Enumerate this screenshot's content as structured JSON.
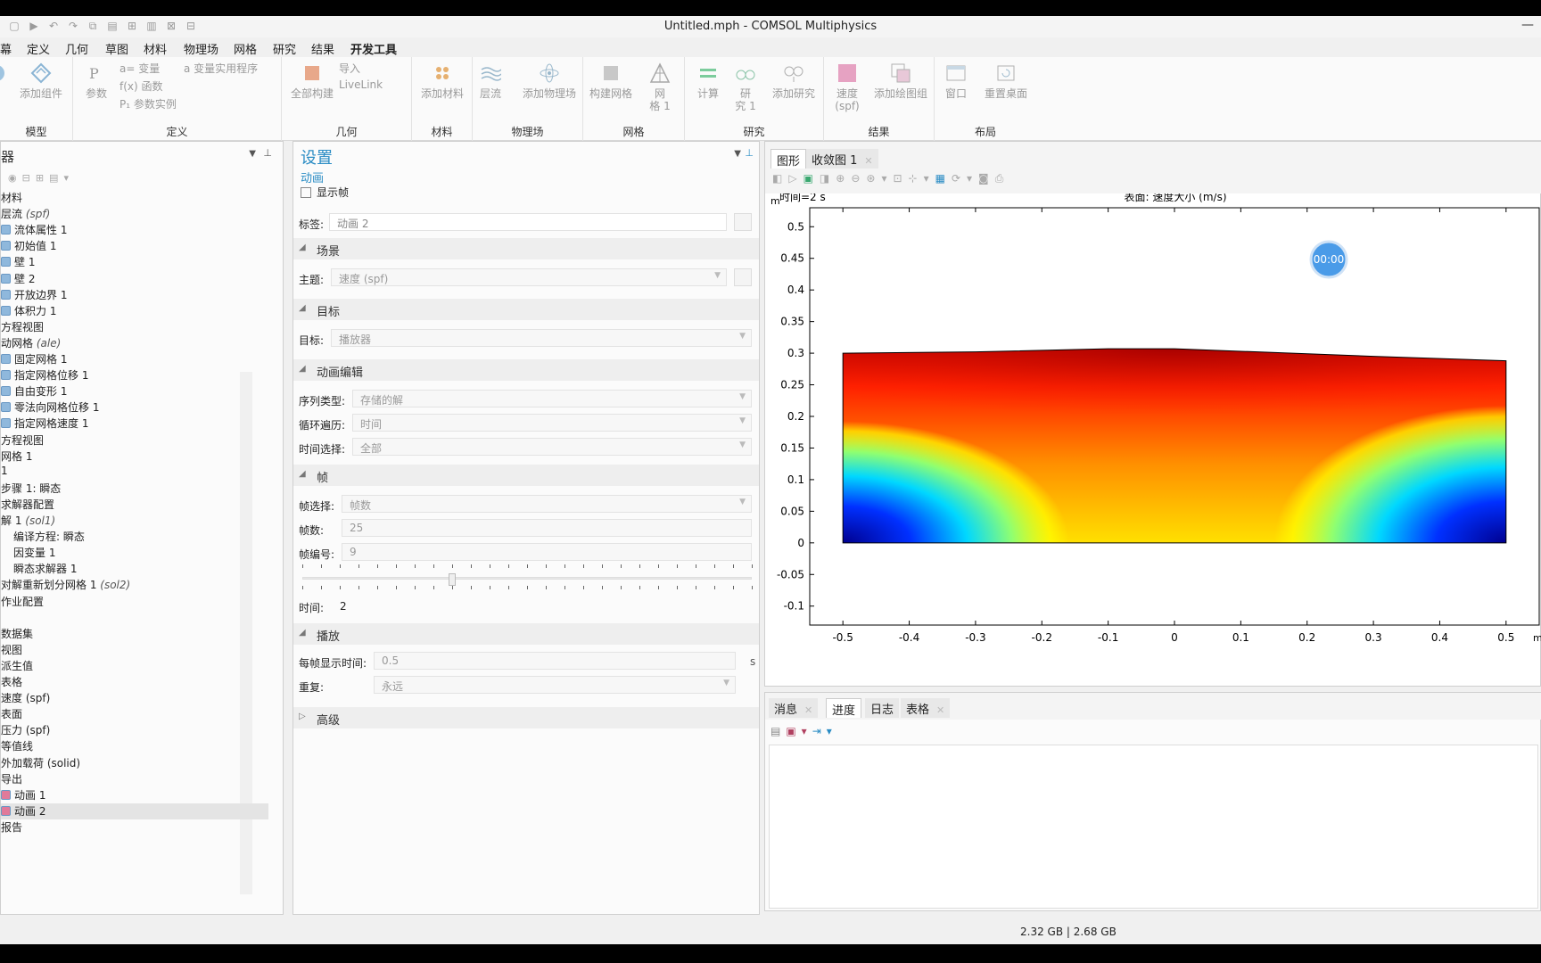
{
  "window": {
    "title": "Untitled.mph - COMSOL Multiphysics"
  },
  "menu": [
    "幕",
    "定义",
    "几何",
    "草图",
    "材料",
    "物理场",
    "网格",
    "研究",
    "结果",
    "开发工具"
  ],
  "ribbon": {
    "groups": {
      "model": "模型",
      "definitions": "定义",
      "geometry": "几何",
      "materials": "材料",
      "physics": "物理场",
      "mesh": "网格",
      "study": "研究",
      "results": "结果",
      "layout": "布局"
    },
    "add_component": "添加组件",
    "parameters": "参数",
    "variables": "a= 变量",
    "functions": "f(x) 函数",
    "param_case": "P₁ 参数实例",
    "var_utils": "a 变量实用程序",
    "build_all": "全部构建",
    "import": "导入",
    "livelink": "LiveLink",
    "add_material": "添加材料",
    "laminar": "层流",
    "add_physics": "添加物理场",
    "build_mesh": "构建网格",
    "mesh1_a": "网",
    "mesh1_b": "格 1",
    "compute": "计算",
    "study1_a": "研",
    "study1_b": "究 1",
    "add_study": "添加研究",
    "velocity_a": "速度",
    "velocity_b": "(spf)",
    "add_plot_group": "添加绘图组",
    "windows": "窗口",
    "reset_desktop": "重置桌面"
  },
  "model_builder": {
    "title": "器",
    "items": [
      {
        "text": "材料",
        "italic": ""
      },
      {
        "text": "层流 ",
        "italic": "(spf)"
      },
      {
        "text": "流体属性 1",
        "italic": ""
      },
      {
        "text": "初始值 1",
        "italic": ""
      },
      {
        "text": "壁 1",
        "italic": ""
      },
      {
        "text": "壁 2",
        "italic": ""
      },
      {
        "text": "开放边界 1",
        "italic": ""
      },
      {
        "text": "体积力 1",
        "italic": ""
      },
      {
        "text": "方程视图",
        "italic": ""
      },
      {
        "text": "动网格 ",
        "italic": "(ale)"
      },
      {
        "text": "固定网格 1",
        "italic": ""
      },
      {
        "text": "指定网格位移 1",
        "italic": ""
      },
      {
        "text": "自由变形 1",
        "italic": ""
      },
      {
        "text": "零法向网格位移 1",
        "italic": ""
      },
      {
        "text": "指定网格速度 1",
        "italic": ""
      },
      {
        "text": "方程视图",
        "italic": ""
      },
      {
        "text": "网格 1",
        "italic": ""
      },
      {
        "text": "1",
        "italic": ""
      },
      {
        "text": "步骤 1: 瞬态",
        "italic": ""
      },
      {
        "text": "求解器配置",
        "italic": ""
      },
      {
        "text": "解 1 ",
        "italic": "(sol1)"
      },
      {
        "text": "编译方程: 瞬态",
        "italic": ""
      },
      {
        "text": "因变量 1",
        "italic": ""
      },
      {
        "text": "瞬态求解器 1",
        "italic": ""
      },
      {
        "text": "对解重新划分网格 1 ",
        "italic": "(sol2)"
      },
      {
        "text": "作业配置",
        "italic": ""
      },
      {
        "text": "",
        "italic": ""
      },
      {
        "text": "数据集",
        "italic": ""
      },
      {
        "text": "视图",
        "italic": ""
      },
      {
        "text": "派生值",
        "italic": ""
      },
      {
        "text": "表格",
        "italic": ""
      },
      {
        "text": "速度 (spf)",
        "italic": ""
      },
      {
        "text": "表面",
        "italic": ""
      },
      {
        "text": "压力 (spf)",
        "italic": ""
      },
      {
        "text": "等值线",
        "italic": ""
      },
      {
        "text": "外加载荷 (solid)",
        "italic": ""
      },
      {
        "text": "导出",
        "italic": ""
      },
      {
        "text": "动画 1",
        "italic": ""
      },
      {
        "text": "动画 2",
        "italic": ""
      },
      {
        "text": "报告",
        "italic": ""
      }
    ]
  },
  "settings": {
    "title": "设置",
    "subtitle": "动画",
    "show_frame": "显示帧",
    "label_label": "标签:",
    "label_value": "动画 2",
    "sections": {
      "scene": "场景",
      "target": "目标",
      "editing": "动画编辑",
      "frames": "帧",
      "playing": "播放",
      "advanced": "高级"
    },
    "subject_label": "主题:",
    "subject_value": "速度 (spf)",
    "target_label": "目标:",
    "target_value": "播放器",
    "seq_type_label": "序列类型:",
    "seq_type_value": "存储的解",
    "loop_label": "循环遍历:",
    "loop_value": "时间",
    "time_sel_label": "时间选择:",
    "time_sel_value": "全部",
    "frame_sel_label": "帧选择:",
    "frame_sel_value": "帧数",
    "frames_label": "帧数:",
    "frames_value": "25",
    "frame_num_label": "帧编号:",
    "frame_num_value": "9",
    "slider_position": 0.33,
    "time_label": "时间:",
    "time_value": "2",
    "display_time_label": "每帧显示时间:",
    "display_time_value": "0.5",
    "display_time_unit": "s",
    "repeat_label": "重复:",
    "repeat_value": "永远"
  },
  "graphics": {
    "tab_graphics": "图形",
    "tab_convergence": "收敛图 1",
    "time_text": "时间=2 s",
    "surface_title": "表面: 速度大小 (m/s)",
    "yunit": "m",
    "xunit": "m",
    "timer": "00:00"
  },
  "chart_data": {
    "type": "heatmap",
    "title": "表面: 速度大小 (m/s)",
    "subtitle": "时间=2 s",
    "xlabel": "m",
    "ylabel": "m",
    "xlim": [
      -0.55,
      0.55
    ],
    "ylim": [
      -0.13,
      0.53
    ],
    "xticks": [
      "-0.5",
      "-0.4",
      "-0.3",
      "-0.2",
      "-0.1",
      "0",
      "0.1",
      "0.2",
      "0.3",
      "0.4",
      "0.5"
    ],
    "yticks": [
      "0.5",
      "0.45",
      "0.4",
      "0.35",
      "0.3",
      "0.25",
      "0.2",
      "0.15",
      "0.1",
      "0.05",
      "0",
      "-0.05",
      "-0.1"
    ],
    "domain_top": [
      [
        -0.5,
        0.3
      ],
      [
        -0.3,
        0.302
      ],
      [
        -0.1,
        0.307
      ],
      [
        0.0,
        0.307
      ],
      [
        0.1,
        0.303
      ],
      [
        0.3,
        0.295
      ],
      [
        0.5,
        0.288
      ]
    ],
    "domain_bottom": 0
  },
  "messages": {
    "tabs": [
      "消息",
      "进度",
      "日志",
      "表格"
    ]
  },
  "status": {
    "memory": "2.32 GB | 2.68 GB"
  },
  "colors": {
    "accent": "#2a8cc4",
    "selection": "#e4e4e4"
  }
}
